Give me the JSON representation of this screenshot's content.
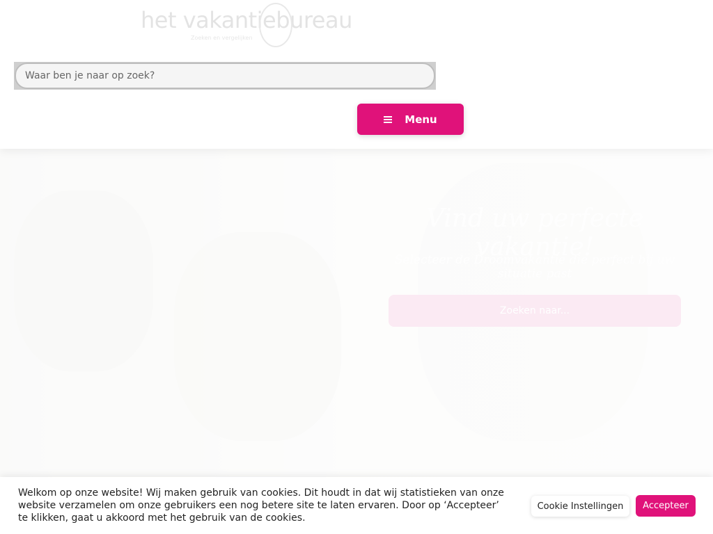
{
  "header": {
    "logo_text": "het vakantiebureau",
    "logo_tagline": "Zoeken en vergelijken",
    "search": {
      "placeholder": "Waar ben je naar op zoek?",
      "value": ""
    },
    "menu_label": "Menu"
  },
  "hero": {
    "title": "Vind uw perfecte vakantie!",
    "subtitle": "Selecteer de Droomvakantie die perfect bij uw situatie past",
    "cta_label": "Zoeken naar..."
  },
  "cookie": {
    "message": "Welkom op onze website! Wij maken gebruik van cookies. Dit houdt in dat wij statistieken van onze website verzamelen om onze gebruikers een nog betere site te laten ervaren. Door op ‘Accepteer’ te klikken, gaat u akkoord met het gebruik van de cookies.",
    "settings_label": "Cookie Instellingen",
    "accept_label": "Accepteer"
  },
  "colors": {
    "brand": "#e0127a"
  }
}
